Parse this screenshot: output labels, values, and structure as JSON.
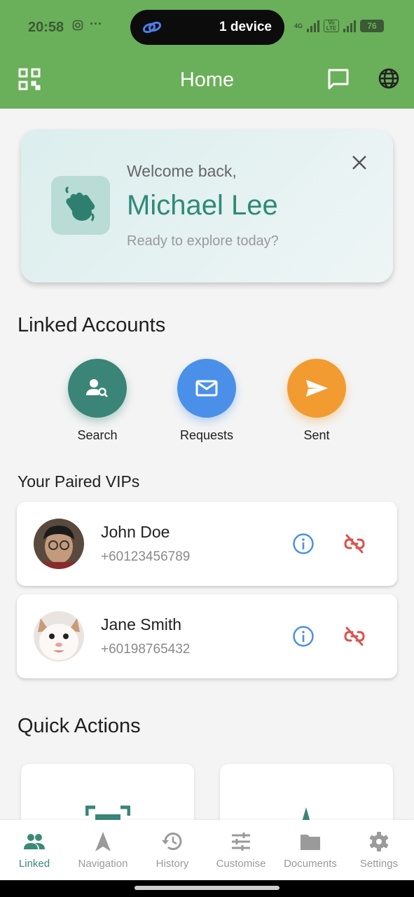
{
  "status_bar": {
    "time": "20:58",
    "pill_label": "1 device",
    "network_tag": "4G",
    "volte_tag": "Vo LTE",
    "battery": "76"
  },
  "app_bar": {
    "title": "Home",
    "left_icon": "qr-code-icon",
    "right_icons": [
      "chat-icon",
      "globe-icon"
    ]
  },
  "welcome": {
    "greeting": "Welcome back,",
    "name": "Michael Lee",
    "subtitle": "Ready to explore today?"
  },
  "linked_accounts": {
    "heading": "Linked Accounts",
    "actions": [
      {
        "label": "Search",
        "icon": "person-search-icon",
        "color": "#3a8578"
      },
      {
        "label": "Requests",
        "icon": "mail-icon",
        "color": "#4a90e8"
      },
      {
        "label": "Sent",
        "icon": "send-icon",
        "color": "#f29b30"
      }
    ]
  },
  "paired_vips": {
    "heading": "Your Paired VIPs",
    "items": [
      {
        "name": "John Doe",
        "phone": "+60123456789"
      },
      {
        "name": "Jane Smith",
        "phone": "+60198765432"
      }
    ]
  },
  "quick_actions": {
    "heading": "Quick Actions"
  },
  "bottom_nav": {
    "active": "Linked",
    "items": [
      {
        "label": "Linked",
        "icon": "people-icon"
      },
      {
        "label": "Navigation",
        "icon": "navigation-arrow-icon"
      },
      {
        "label": "History",
        "icon": "history-icon"
      },
      {
        "label": "Customise",
        "icon": "sliders-icon"
      },
      {
        "label": "Documents",
        "icon": "folder-icon"
      },
      {
        "label": "Settings",
        "icon": "gear-icon"
      }
    ]
  },
  "colors": {
    "primary": "#6aaf5a",
    "accent": "#2f8a78",
    "info": "#4a90e8",
    "danger": "#d9534f"
  }
}
